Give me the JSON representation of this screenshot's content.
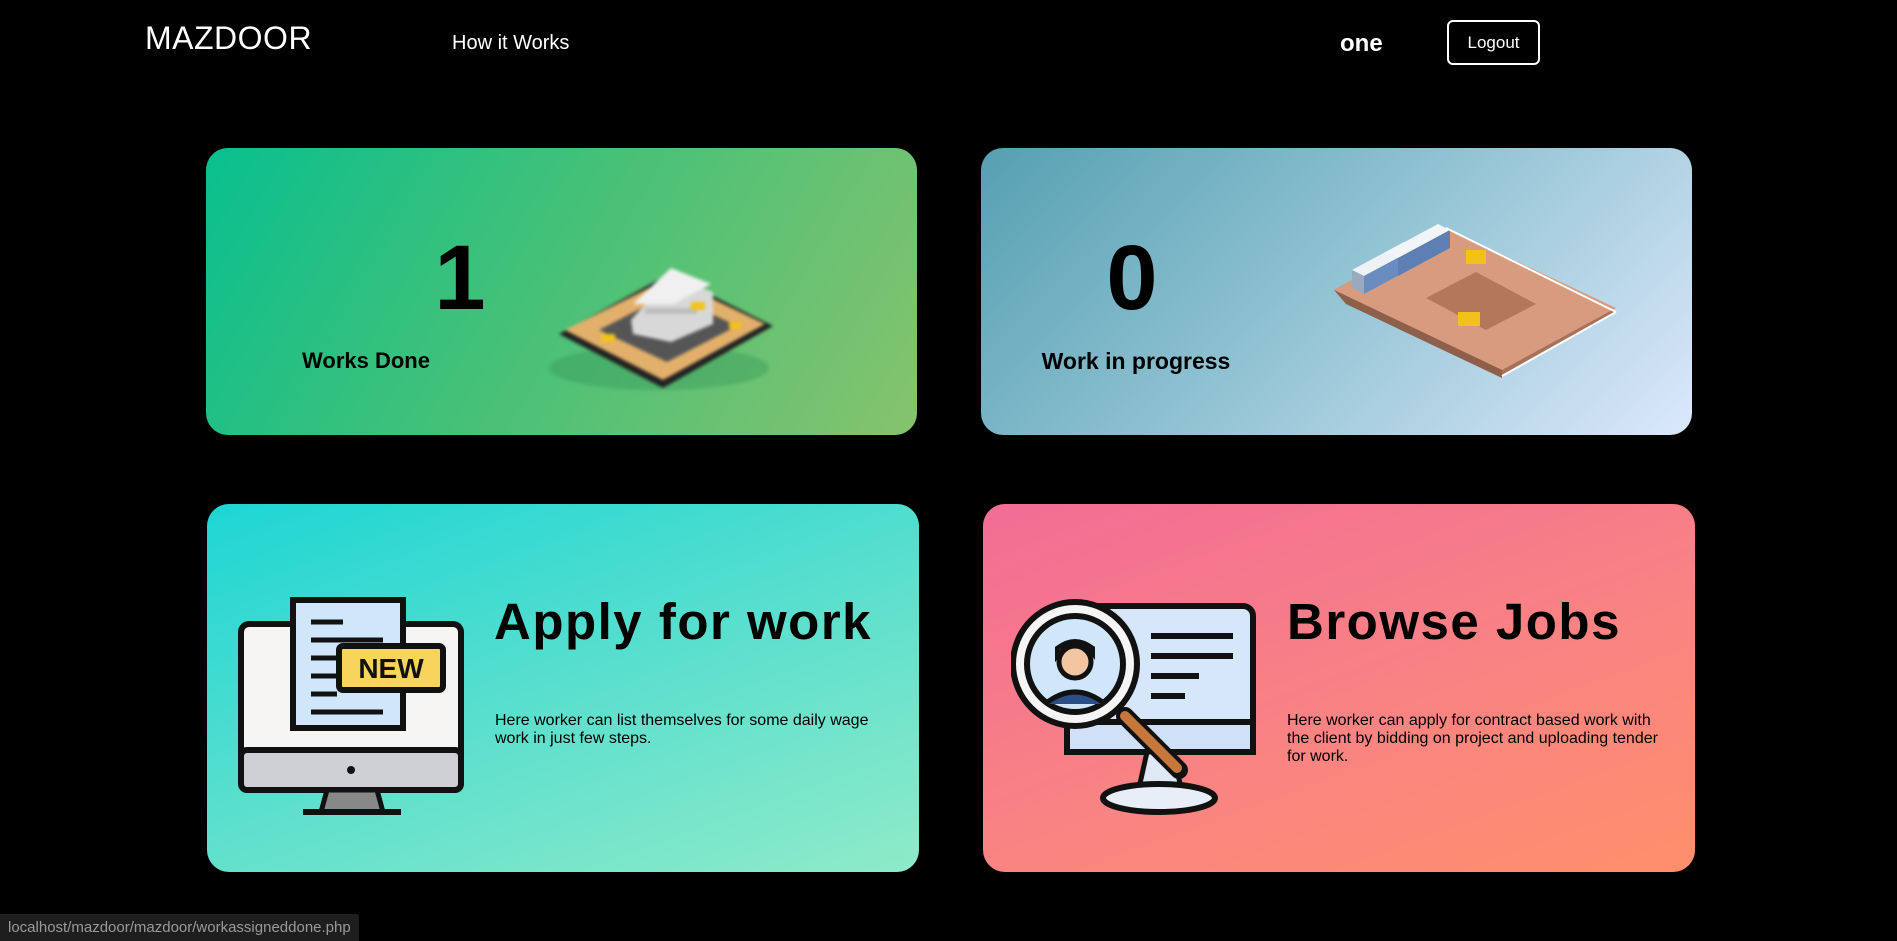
{
  "nav": {
    "brand": "MAZDOOR",
    "how_it_works": "How it Works",
    "username": "one",
    "logout": "Logout"
  },
  "stats": {
    "works_done": {
      "value": "1",
      "label": "Works Done"
    },
    "work_in_progress": {
      "value": "0",
      "label": "Work in progress"
    }
  },
  "apply": {
    "title": "Apply for work",
    "description": "Here worker can list themselves for some daily wage work in just few steps.",
    "badge": "NEW"
  },
  "browse": {
    "title": "Browse Jobs",
    "description": "Here worker can apply for contract based work with the client by bidding on project and uploading tender for work."
  },
  "status_bar": {
    "url": "localhost/mazdoor/mazdoor/workassigneddone.php"
  },
  "colors": {
    "background": "#000000",
    "done_card": "#43c178",
    "progress_card": "#93c4d4",
    "apply_card": "#5fe0cd",
    "browse_card": "#f98383"
  },
  "icons": {
    "works_done": "phone-construction-icon",
    "progress": "construction-site-icon",
    "apply": "monitor-new-document-icon",
    "browse": "monitor-search-person-icon"
  }
}
